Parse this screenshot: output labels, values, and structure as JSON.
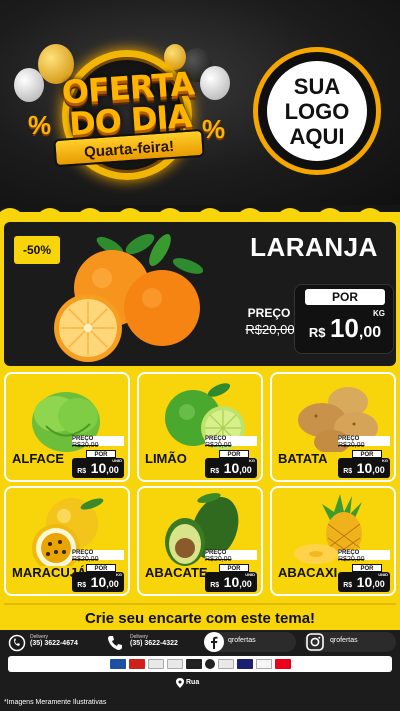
{
  "header": {
    "badge_title_line1": "OFERTA",
    "badge_title_line2": "DO DIA",
    "badge_subtitle": "Quarta-feira!",
    "logo_text": "SUA\nLOGO\nAQUI"
  },
  "hero": {
    "discount": "-50%",
    "name": "LARANJA",
    "preco_label": "PREÇO",
    "old_price": "R$20,00",
    "por_label": "POR",
    "currency": "R$",
    "price_int": "10",
    "price_dec": ",00",
    "unit": "KG"
  },
  "products": [
    {
      "name": "ALFACE",
      "preco_label": "PREÇO",
      "old_price": "R$20,00",
      "por_label": "POR",
      "currency": "R$",
      "price_int": "10",
      "price_dec": ",00",
      "unit": "UNID"
    },
    {
      "name": "LIMÃO",
      "preco_label": "PREÇO",
      "old_price": "R$20,00",
      "por_label": "POR",
      "currency": "R$",
      "price_int": "10",
      "price_dec": ",00",
      "unit": "KG"
    },
    {
      "name": "BATATA",
      "preco_label": "PREÇO",
      "old_price": "R$20,00",
      "por_label": "POR",
      "currency": "R$",
      "price_int": "10",
      "price_dec": ",00",
      "unit": "KG"
    },
    {
      "name": "MARACUJÁ",
      "preco_label": "PREÇO",
      "old_price": "R$20,00",
      "por_label": "POR",
      "currency": "R$",
      "price_int": "10",
      "price_dec": ",00",
      "unit": "KG"
    },
    {
      "name": "ABACATE",
      "preco_label": "PREÇO",
      "old_price": "R$20,00",
      "por_label": "POR",
      "currency": "R$",
      "price_int": "10",
      "price_dec": ",00",
      "unit": "UNID"
    },
    {
      "name": "ABACAXI",
      "preco_label": "PREÇO",
      "old_price": "R$20,00",
      "por_label": "POR",
      "currency": "R$",
      "price_int": "10",
      "price_dec": ",00",
      "unit": "UNID"
    }
  ],
  "cta": "Crie seu encarte com este tema!",
  "footer": {
    "whatsapp_label": "Delivery",
    "whatsapp_number": "(35) 3622-4674",
    "phone_label": "Delivery",
    "phone_number": "(35) 3622-4322",
    "facebook": "qrofertas",
    "instagram": "qrofertas",
    "address": "Rua",
    "disclaimer": "*Imagens Meramente Ilustrativas"
  },
  "colors": {
    "accent": "#f8d40b",
    "dark": "#151515",
    "orange": "#f5a700"
  },
  "icons": [
    "whatsapp-icon",
    "phone-icon",
    "facebook-icon",
    "instagram-icon",
    "location-pin-icon"
  ]
}
